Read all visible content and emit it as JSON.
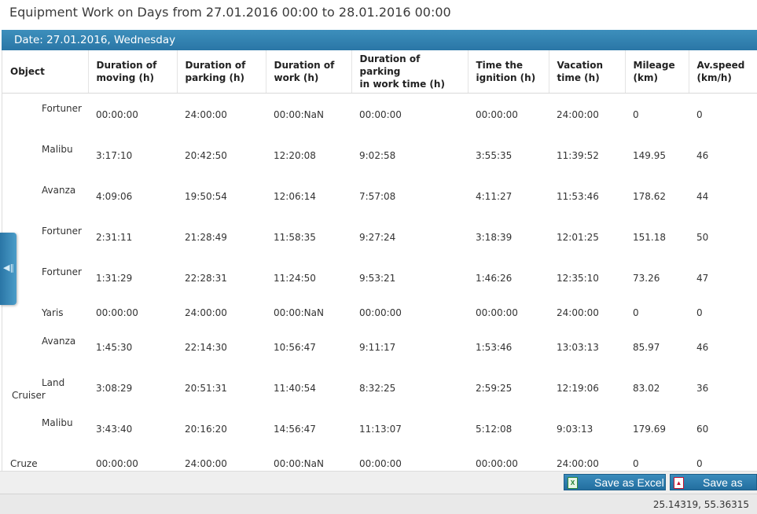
{
  "title": "Equipment Work on Days from 27.01.2016 00:00 to 28.01.2016 00:00",
  "date_bar": "Date: 27.01.2016, Wednesday",
  "columns": [
    {
      "line1": "Object",
      "line2": ""
    },
    {
      "line1": "Duration of",
      "line2": "moving (h)"
    },
    {
      "line1": "Duration of",
      "line2": "parking (h)"
    },
    {
      "line1": "Duration of",
      "line2": "work (h)"
    },
    {
      "line1": "Duration of parking",
      "line2": "in work time (h)"
    },
    {
      "line1": "Time the",
      "line2": "ignition (h)"
    },
    {
      "line1": "Vacation",
      "line2": "time (h)"
    },
    {
      "line1": "Mileage",
      "line2": "(km)"
    },
    {
      "line1": "Av.speed",
      "line2": "(km/h)"
    }
  ],
  "rows": [
    {
      "object": "Fortuner",
      "moving": "00:00:00",
      "parking": "24:00:00",
      "work": "00:00:NaN",
      "parking_work": "00:00:00",
      "ignition": "00:00:00",
      "vacation": "24:00:00",
      "mileage": "0",
      "speed": "0"
    },
    {
      "object": "Malibu",
      "moving": "3:17:10",
      "parking": "20:42:50",
      "work": "12:20:08",
      "parking_work": "9:02:58",
      "ignition": "3:55:35",
      "vacation": "11:39:52",
      "mileage": "149.95",
      "speed": "46"
    },
    {
      "object": "Avanza",
      "moving": "4:09:06",
      "parking": "19:50:54",
      "work": "12:06:14",
      "parking_work": "7:57:08",
      "ignition": "4:11:27",
      "vacation": "11:53:46",
      "mileage": "178.62",
      "speed": "44"
    },
    {
      "object": "Fortuner",
      "moving": "2:31:11",
      "parking": "21:28:49",
      "work": "11:58:35",
      "parking_work": "9:27:24",
      "ignition": "3:18:39",
      "vacation": "12:01:25",
      "mileage": "151.18",
      "speed": "50"
    },
    {
      "object": "Fortuner",
      "moving": "1:31:29",
      "parking": "22:28:31",
      "work": "11:24:50",
      "parking_work": "9:53:21",
      "ignition": "1:46:26",
      "vacation": "12:35:10",
      "mileage": "73.26",
      "speed": "47"
    },
    {
      "object": "Yaris",
      "moving": "00:00:00",
      "parking": "24:00:00",
      "work": "00:00:NaN",
      "parking_work": "00:00:00",
      "ignition": "00:00:00",
      "vacation": "24:00:00",
      "mileage": "0",
      "speed": "0"
    },
    {
      "object": "Avanza",
      "moving": "1:45:30",
      "parking": "22:14:30",
      "work": "10:56:47",
      "parking_work": "9:11:17",
      "ignition": "1:53:46",
      "vacation": "13:03:13",
      "mileage": "85.97",
      "speed": "46"
    },
    {
      "object": "Land Cruiser",
      "moving": "3:08:29",
      "parking": "20:51:31",
      "work": "11:40:54",
      "parking_work": "8:32:25",
      "ignition": "2:59:25",
      "vacation": "12:19:06",
      "mileage": "83.02",
      "speed": "36"
    },
    {
      "object": "Malibu",
      "moving": "3:43:40",
      "parking": "20:16:20",
      "work": "14:56:47",
      "parking_work": "11:13:07",
      "ignition": "5:12:08",
      "vacation": "9:03:13",
      "mileage": "179.69",
      "speed": "60"
    },
    {
      "object": "Cruze",
      "moving": "00:00:00",
      "parking": "24:00:00",
      "work": "00:00:NaN",
      "parking_work": "00:00:00",
      "ignition": "00:00:00",
      "vacation": "24:00:00",
      "mileage": "0",
      "speed": "0"
    }
  ],
  "buttons": {
    "excel": "Save as Excel",
    "excel_icon": "excel-icon",
    "pdf": "Save as PDF",
    "pdf_icon": "pdf-icon"
  },
  "side_tab_icon": "collapse-panel-icon",
  "coordinates": "25.14319, 55.36315",
  "colors": {
    "header_bar": "#2a76a6",
    "button": "#236e9f"
  }
}
